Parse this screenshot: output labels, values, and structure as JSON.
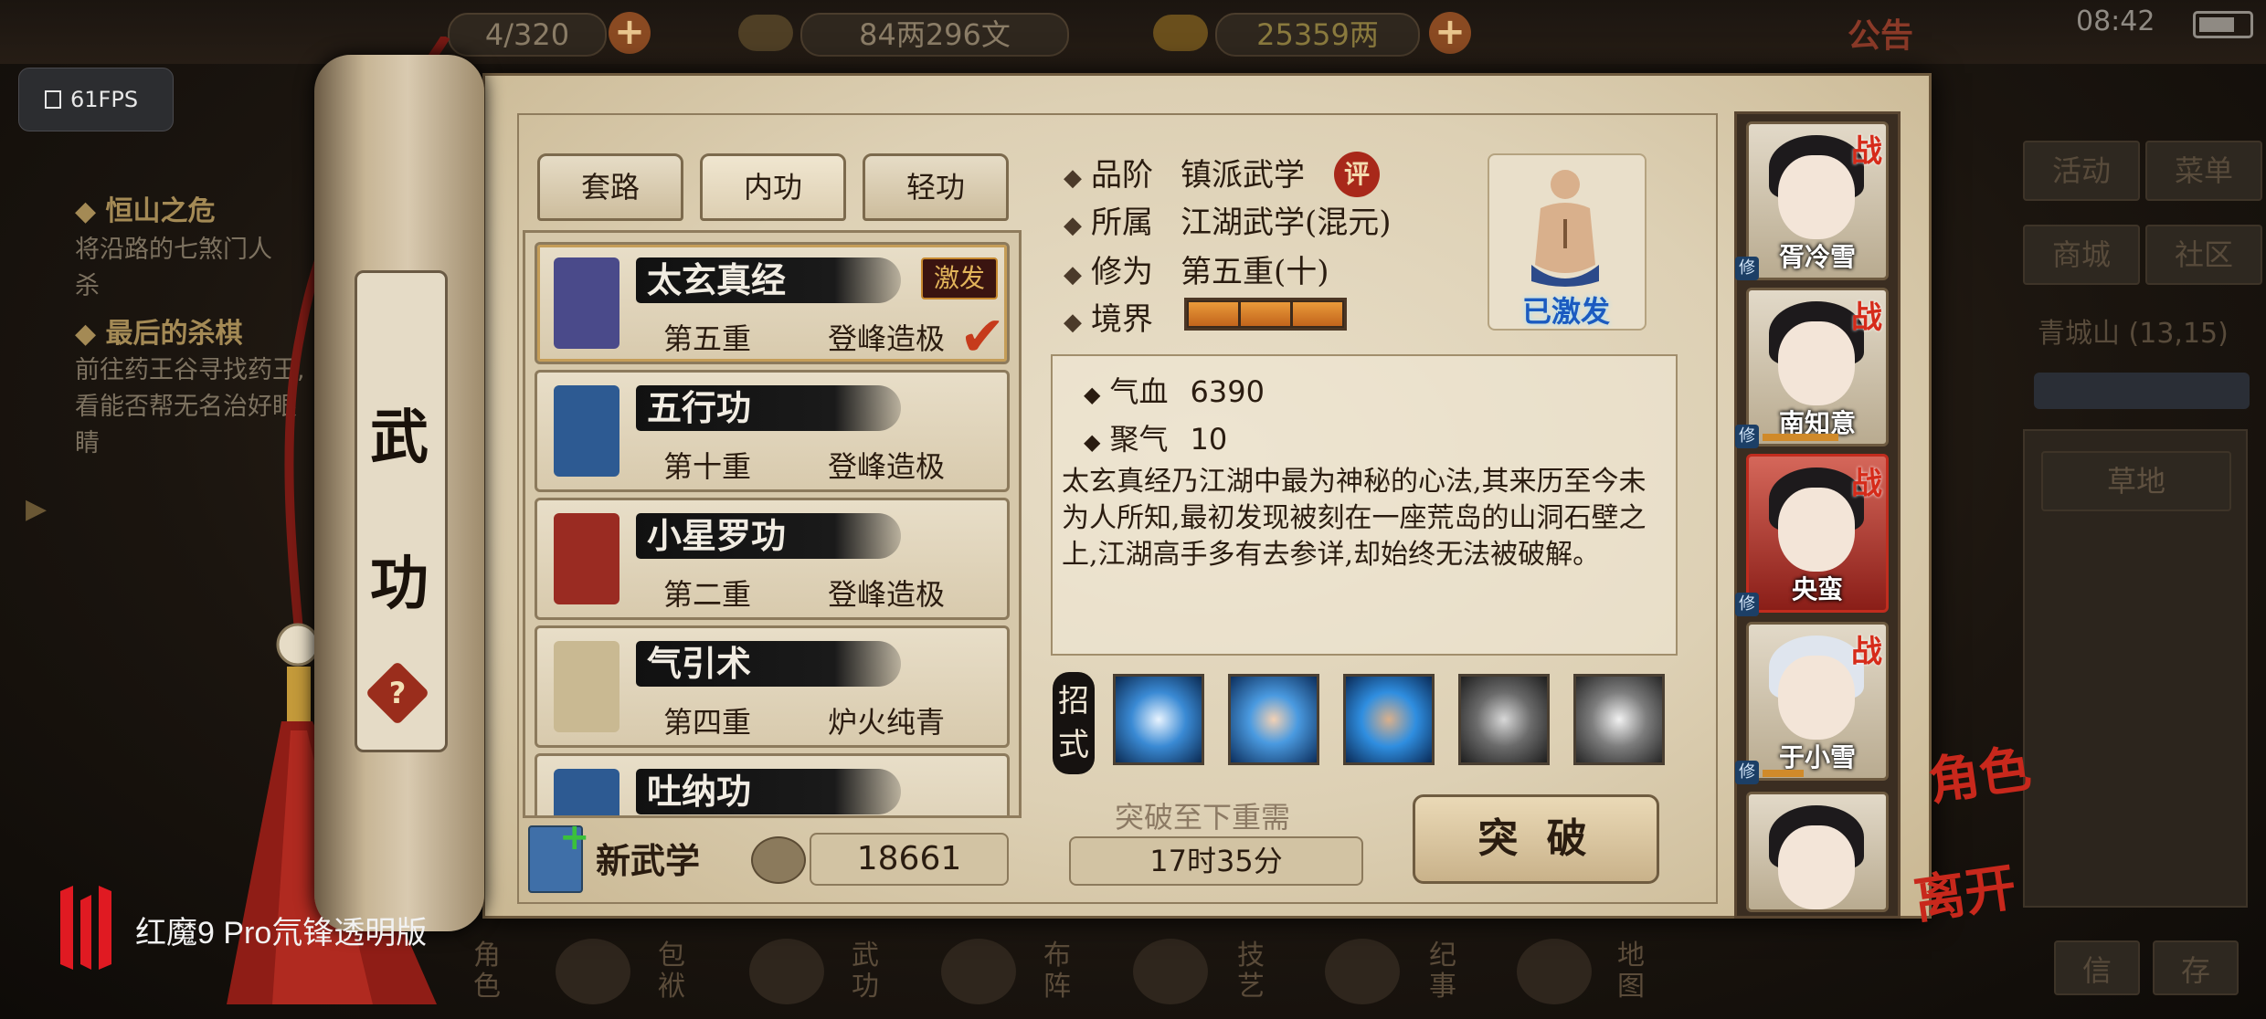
{
  "status": {
    "clock": "08:42"
  },
  "top_bar": {
    "storage_value": "4/320",
    "silver": "84两296文",
    "gold": "25359两",
    "notice": "公告"
  },
  "fps": "61FPS",
  "quests": [
    {
      "title": "恒山之危",
      "text": [
        "将沿路的七煞门人",
        "杀"
      ]
    },
    {
      "title": "最后的杀棋",
      "text": [
        "前往药王谷寻找药王,",
        "看能否帮无名治好眼",
        "睛"
      ]
    }
  ],
  "right_menu": {
    "buttons": [
      "活动",
      "菜单",
      "商城",
      "社区"
    ],
    "location": "青城山",
    "coords": "(13,15)",
    "terrain": "草地"
  },
  "bottom_nav": [
    "角色",
    "包袱",
    "武功",
    "布阵",
    "技艺",
    "纪事",
    "地图"
  ],
  "scroll_title": [
    "武",
    "功"
  ],
  "help": "?",
  "tabs": [
    "套路",
    "内功",
    "轻功"
  ],
  "skills": [
    {
      "name": "太玄真经",
      "level": "第五重",
      "grade": "登峰造极",
      "badge": "激发",
      "selected": true,
      "book_color": "#4a4a8a"
    },
    {
      "name": "五行功",
      "level": "第十重",
      "grade": "登峰造极",
      "book_color": "#2d5a92"
    },
    {
      "name": "小星罗功",
      "level": "第二重",
      "grade": "登峰造极",
      "book_color": "#9a2b22"
    },
    {
      "name": "气引术",
      "level": "第四重",
      "grade": "炉火纯青",
      "book_color": "#c9b992"
    },
    {
      "name": "吐纳功",
      "level": "",
      "grade": "",
      "book_color": "#2d5a92"
    }
  ],
  "new_skill_label": "新武学",
  "points": "18661",
  "attributes": {
    "rank_label": "品阶",
    "rank_value": "镇派武学",
    "rank_badge": "评",
    "belong_label": "所属",
    "belong_value": "江湖武学(混元)",
    "cult_label": "修为",
    "cult_value": "第五重(十)",
    "realm_label": "境界"
  },
  "portrait_status": "已激发",
  "stats": [
    {
      "label": "气血",
      "value": "6390"
    },
    {
      "label": "聚气",
      "value": "10"
    }
  ],
  "description": "太玄真经乃江湖中最为神秘的心法,其来历至今未为人所知,最初发现被刻在一座荒岛的山洞石壁之上,江湖高手多有去参详,却始终无法被破解。",
  "moves_label": [
    "招",
    "式"
  ],
  "breakthrough": {
    "need_label": "突破至下重需",
    "time": "17时35分",
    "button": "突 破"
  },
  "characters": [
    {
      "name": "胥冷雪",
      "battle": "战",
      "xiu": "修",
      "xp": 0.0,
      "selected": false,
      "hair": "dark"
    },
    {
      "name": "南知意",
      "battle": "战",
      "xiu": "修",
      "xp": 0.55,
      "selected": false,
      "hair": "dark"
    },
    {
      "name": "央蛮",
      "battle": "战",
      "xiu": "修",
      "xp": 0.0,
      "selected": true,
      "hair": "dark"
    },
    {
      "name": "于小雪",
      "battle": "战",
      "xiu": "修",
      "xp": 0.3,
      "selected": false,
      "hair": "white"
    },
    {
      "name": "",
      "battle": "",
      "xiu": "",
      "xp": 0.0,
      "selected": false,
      "hair": "dark"
    }
  ],
  "side_buttons": {
    "role": "角色",
    "leave": "离开"
  },
  "watermark": "红魔9 Pro氘锋透明版",
  "colors": {
    "accent_red": "#c8281c",
    "parchment": "#e3d8c2",
    "ink": "#2a1c10",
    "realm_fill": "#e99a3a"
  }
}
